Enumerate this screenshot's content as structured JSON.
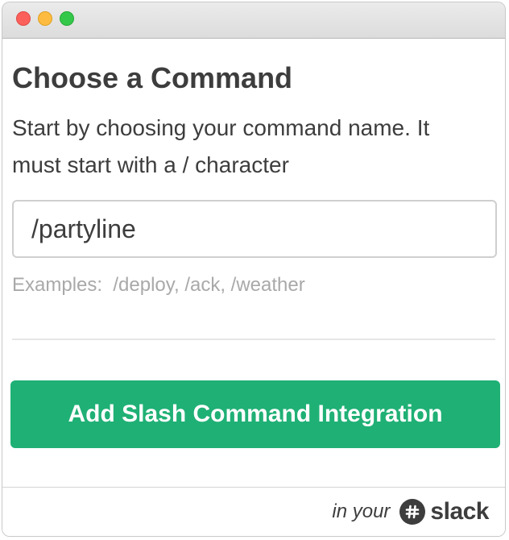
{
  "window": {
    "controls": [
      "close",
      "minimize",
      "maximize"
    ]
  },
  "main": {
    "title": "Choose a Command",
    "description": "Start by choosing your command name. It must start with a / character",
    "command_input": {
      "value": "/partyline",
      "placeholder": ""
    },
    "examples": "Examples:  /deploy, /ack, /weather",
    "add_button_label": "Add Slash Command Integration"
  },
  "footer": {
    "prefix": "in your",
    "brand": "slack"
  },
  "colors": {
    "accent": "#1fb075",
    "text": "#3d3d3d",
    "muted": "#a9a9a9"
  }
}
